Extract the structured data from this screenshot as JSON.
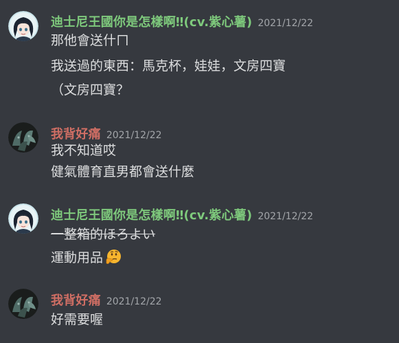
{
  "colors": {
    "background": "#36393f",
    "user_green": "#7ec97c",
    "user_red": "#cf6e64",
    "timestamp": "#a3a6aa",
    "message_text": "#dcddde"
  },
  "messages": [
    {
      "username": "迪士尼王國你是怎樣啊‼(cv.紫心薯)",
      "timestamp": "2021/12/22",
      "avatar_icon": "anime-girl-avatar",
      "lines": [
        "那他會送什ㄇ",
        "我送過的東西：馬克杯，娃娃，文房四寶",
        "（文房四寶？"
      ]
    },
    {
      "username": "我背好痛",
      "timestamp": "2021/12/22",
      "avatar_icon": "ghost-avatar",
      "lines": [
        "我不知道哎",
        "健氣體育直男都會送什麼"
      ]
    },
    {
      "username": "迪士尼王國你是怎樣啊‼(cv.紫心薯)",
      "timestamp": "2021/12/22",
      "avatar_icon": "anime-girl-avatar",
      "lines": [
        "一整箱的ほろよい",
        "運動用品"
      ],
      "struck_line_index": 0,
      "emoji": "thinking-face-emoji"
    },
    {
      "username": "我背好痛",
      "timestamp": "2021/12/22",
      "avatar_icon": "ghost-avatar",
      "lines": [
        "好需要喔"
      ]
    }
  ]
}
